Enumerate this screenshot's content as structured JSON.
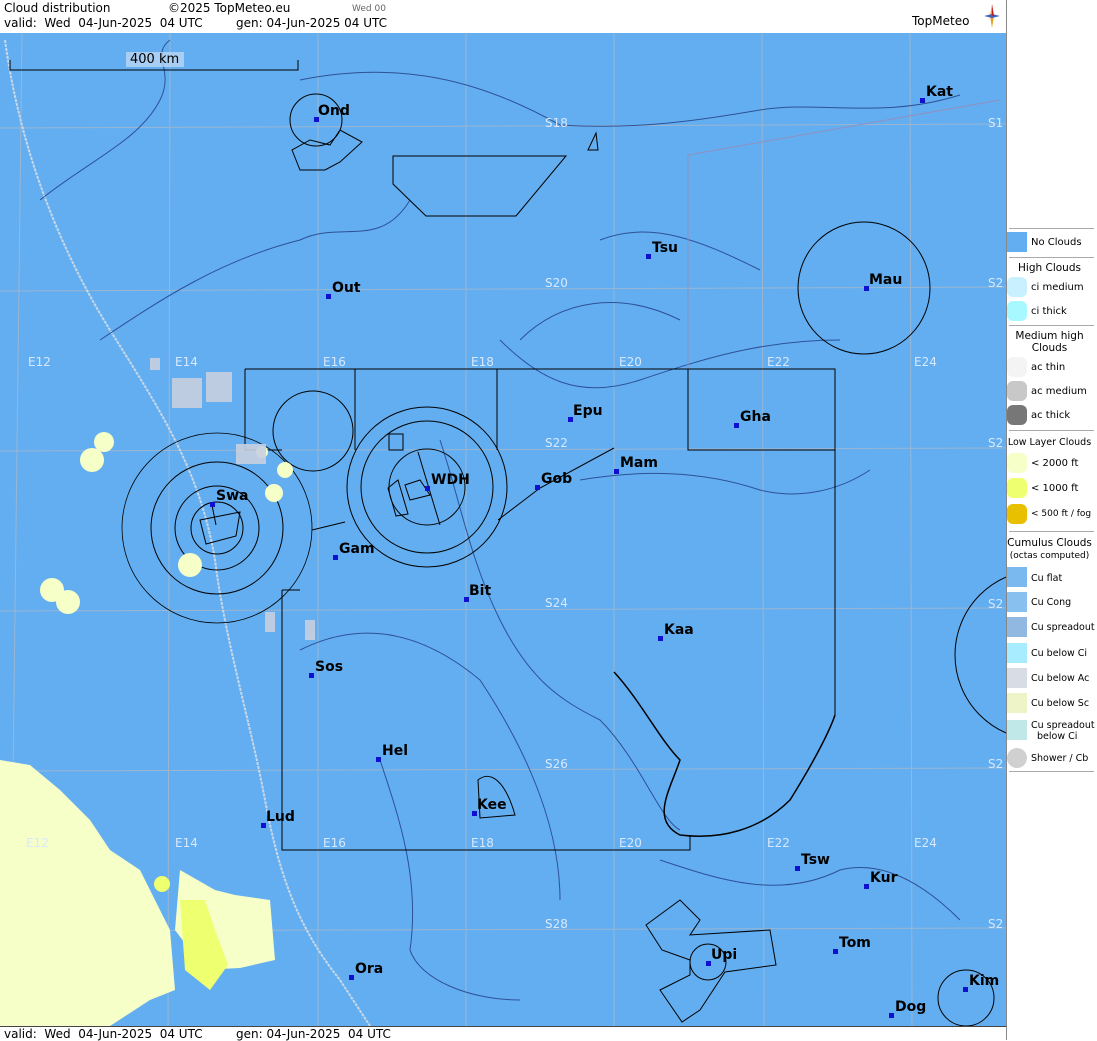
{
  "header": {
    "title": "Cloud distribution",
    "copyright": "©2025 TopMeteo.eu",
    "run_tag": "Wed 00",
    "valid": "valid:  Wed  04-Jun-2025  04 UTC",
    "gen": "gen: 04-Jun-2025 04 UTC",
    "brand": "TopMeteo"
  },
  "footer": {
    "valid": "valid:  Wed  04-Jun-2025  04 UTC",
    "gen": "gen: 04-Jun-2025  04 UTC"
  },
  "scale": {
    "label": "400 km"
  },
  "grid_labels": {
    "e12a": "E12",
    "e14a": "E14",
    "e16a": "E16",
    "e18a": "E18",
    "e20a": "E20",
    "e22a": "E22",
    "e24a": "E24",
    "e12b": "E12",
    "e14b": "E14",
    "e16b": "E16",
    "e18b": "E18",
    "e20b": "E20",
    "e22b": "E22",
    "e24b": "E24",
    "s18": "S18",
    "s20": "S20",
    "s22": "S22",
    "s24": "S24",
    "s26": "S26",
    "s28": "S28",
    "s18r": "S1",
    "s20r": "S2",
    "s22r": "S2",
    "s24r": "S2",
    "s26r": "S2",
    "s28r": "S2"
  },
  "cities": {
    "ond": "Ond",
    "kat": "Kat",
    "tsu": "Tsu",
    "mau": "Mau",
    "out": "Out",
    "epu": "Epu",
    "gha": "Gha",
    "mam": "Mam",
    "gob": "Gob",
    "wdh": "WDH",
    "swa": "Swa",
    "gam": "Gam",
    "bit": "Bit",
    "kaa": "Kaa",
    "sos": "Sos",
    "hel": "Hel",
    "lud": "Lud",
    "kee": "Kee",
    "tsw": "Tsw",
    "kur": "Kur",
    "tom": "Tom",
    "upi": "Upi",
    "ora": "Ora",
    "dog": "Dog",
    "kim": "Kim"
  },
  "legend": {
    "no_clouds": "No Clouds",
    "high_head": "High Clouds",
    "ci_medium": "ci medium",
    "ci_thick": "ci thick",
    "medium_head": "Medium high Clouds",
    "ac_thin": "ac thin",
    "ac_medium": "ac medium",
    "ac_thick": "ac thick",
    "low_head": "Low Layer Clouds",
    "lt2000": "< 2000 ft",
    "lt1000": "< 1000 ft",
    "lt500": "< 500 ft / fog",
    "cu_head": "Cumulus Clouds",
    "cu_sub": "(octas computed)",
    "cu_flat": "Cu flat",
    "cu_cong": "Cu Cong",
    "cu_spread": "Cu spreadout",
    "cu_below_ci": "Cu below Ci",
    "cu_below_ac": "Cu below Ac",
    "cu_below_sc": "Cu below Sc",
    "cu_spread_ci_1": "Cu spreadout",
    "cu_spread_ci_2": "below Ci",
    "shower": "Shower / Cb"
  },
  "colors": {
    "no_clouds": "#63aef0",
    "ci_medium": "#c8f0ff",
    "ci_thick": "#a8f8ff",
    "ac_thin": "#f4f4f4",
    "ac_medium": "#c8c8c8",
    "ac_thick": "#777777",
    "lt2000": "#f6ffc8",
    "lt1000": "#eeff70",
    "lt500": "#e8c000",
    "city_dot": "#1010d0"
  }
}
